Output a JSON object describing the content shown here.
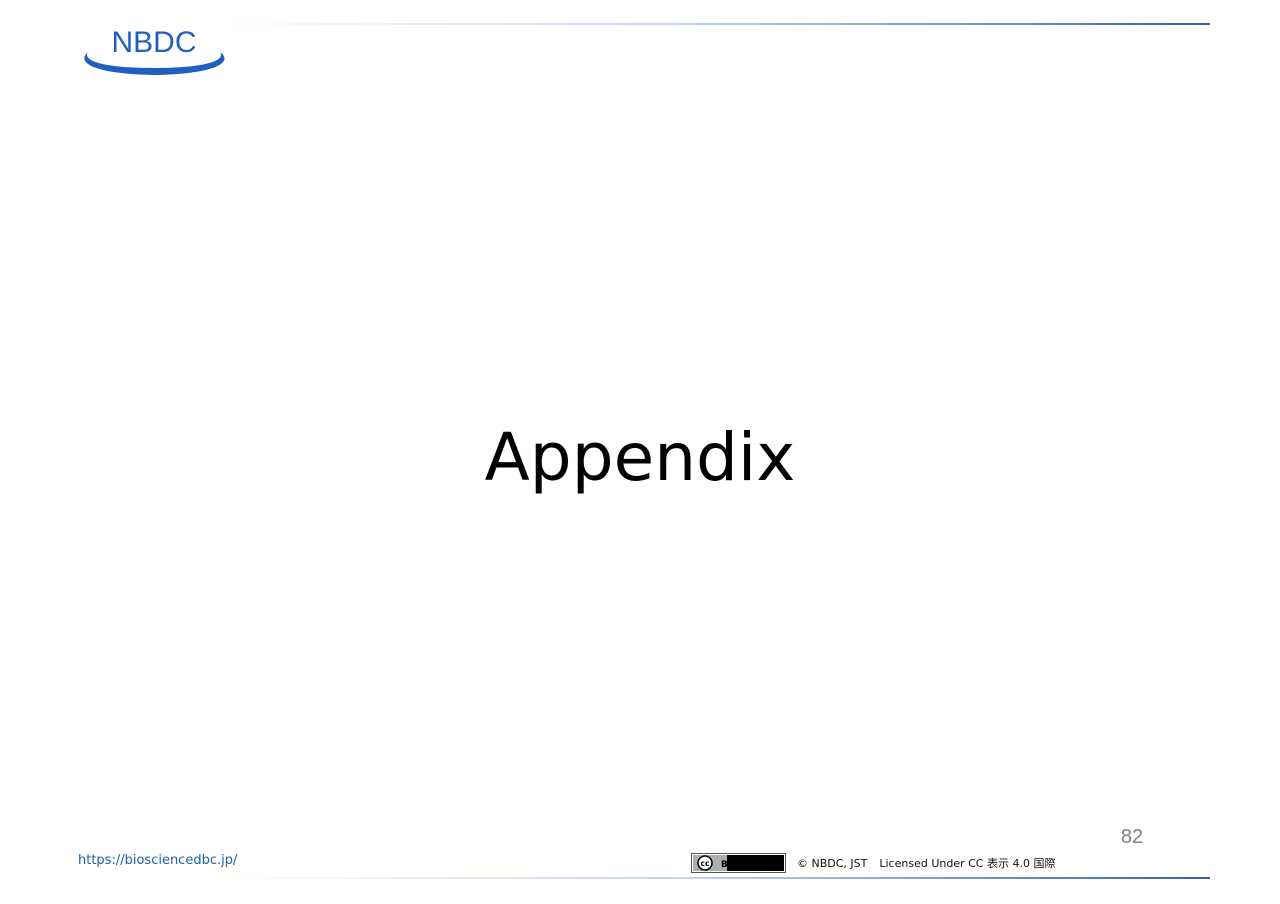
{
  "header": {
    "logo_text": "NBDC"
  },
  "main": {
    "title": "Appendix"
  },
  "footer": {
    "url": "https://biosciencedbc.jp/",
    "cc_badge_text": "BY",
    "cc_badge_icon": "cc-icon",
    "copyright": "© NBDC, JST",
    "license": "Licensed Under CC 表示 4.0 国際",
    "page_number": "82"
  },
  "colors": {
    "brand_blue": "#1f5fbf",
    "rule_blue": "#2f62b8",
    "url_blue": "#1f5fa5",
    "page_number_gray": "#808080"
  }
}
